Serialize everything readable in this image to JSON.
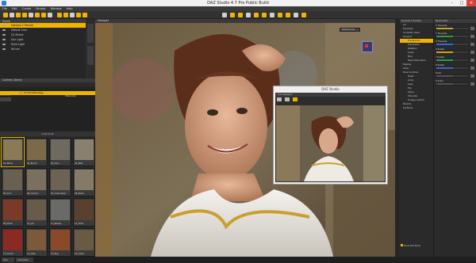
{
  "window": {
    "title": "DAZ Studio 4.7 Pro Public Build"
  },
  "menubar": [
    "File",
    "Edit",
    "Create",
    "Render",
    "Window",
    "Help"
  ],
  "left_tabs": {
    "scene": "Scene"
  },
  "scene_tree": [
    {
      "label": "Genesis 2 Female",
      "selected": true
    },
    {
      "label": "Default Cam",
      "selected": false
    },
    {
      "label": "G2 BlueLt",
      "selected": false
    },
    {
      "label": "Sun Light",
      "selected": false
    },
    {
      "label": "Point Light",
      "selected": false
    },
    {
      "label": "Atrium",
      "selected": false
    }
  ],
  "content": {
    "title": "Content Library",
    "folder_selected": "04 PortalFantasy",
    "folder_child": "Materials",
    "pager": "1-32 of 32",
    "thumbnails": [
      {
        "label": "01_Niche",
        "color": "#8a7a55",
        "selected": true
      },
      {
        "label": "02_Bench",
        "color": "#7a6a4a",
        "selected": false
      },
      {
        "label": "03_Door",
        "color": "#6f6a60",
        "selected": false
      },
      {
        "label": "04_Wall",
        "color": "#8a8070",
        "selected": false
      },
      {
        "label": "05_Arch",
        "color": "#6a6050",
        "selected": false
      },
      {
        "label": "06_Column",
        "color": "#7a7060",
        "selected": false
      },
      {
        "label": "07_Colonnade",
        "color": "#6e6252",
        "selected": false
      },
      {
        "label": "08_Stairs",
        "color": "#857a66",
        "selected": false
      },
      {
        "label": "09_Divan",
        "color": "#7a3a2a",
        "selected": false
      },
      {
        "label": "10_Urn",
        "color": "#6a5a4a",
        "selected": false
      },
      {
        "label": "11_Statue",
        "color": "#6a6a66",
        "selected": false
      },
      {
        "label": "12_Chair",
        "color": "#5a4030",
        "selected": false
      },
      {
        "label": "13_Couch",
        "color": "#8a2a22",
        "selected": false
      },
      {
        "label": "14_Vase",
        "color": "#7a5a3a",
        "selected": false
      },
      {
        "label": "15_Rug",
        "color": "#8a4a2a",
        "selected": false
      },
      {
        "label": "16_Lamp",
        "color": "#6a5a44",
        "selected": false
      }
    ]
  },
  "viewport": {
    "tab": "Viewport",
    "camera": "Default Cam"
  },
  "aux_window": {
    "title": "DAZ Studio",
    "tab": "Aux Viewport"
  },
  "right_panel": {
    "title": "Genesis 2 Female",
    "items": [
      {
        "label": "All",
        "selected": false,
        "sub": false
      },
      {
        "label": "Favorites",
        "selected": false,
        "sub": false
      },
      {
        "label": "Currently Used",
        "selected": false,
        "sub": false
      },
      {
        "label": "General",
        "selected": false,
        "sub": false
      },
      {
        "label": "Transforms",
        "selected": true,
        "sub": true
      },
      {
        "label": "Translation",
        "selected": false,
        "sub": true
      },
      {
        "label": "Rotation",
        "selected": false,
        "sub": true
      },
      {
        "label": "Scale",
        "selected": false,
        "sub": true
      },
      {
        "label": "Misc",
        "selected": false,
        "sub": true
      },
      {
        "label": "Mesh Resolution",
        "selected": false,
        "sub": true
      },
      {
        "label": "Display",
        "selected": false,
        "sub": false
      },
      {
        "label": "Actor",
        "selected": false,
        "sub": false
      },
      {
        "label": "Pose Controls",
        "selected": false,
        "sub": false
      },
      {
        "label": "Head",
        "selected": false,
        "sub": true
      },
      {
        "label": "Arms",
        "selected": false,
        "sub": true
      },
      {
        "label": "Legs",
        "selected": false,
        "sub": true
      },
      {
        "label": "Hip",
        "selected": false,
        "sub": true
      },
      {
        "label": "Spine",
        "selected": false,
        "sub": true
      },
      {
        "label": "Shoulder",
        "selected": false,
        "sub": true
      },
      {
        "label": "Tongue Control",
        "selected": false,
        "sub": true
      },
      {
        "label": "Morphs",
        "selected": false,
        "sub": false
      },
      {
        "label": "Surfaces",
        "selected": false,
        "sub": false
      }
    ],
    "footer": "Show Sub Items"
  },
  "params": {
    "header": "Parameters",
    "rows": [
      {
        "label": "X Translate",
        "fill": 0.5,
        "color": "#c9a420"
      },
      {
        "label": "Y Translate",
        "fill": 0.5,
        "color": "#2fa04a"
      },
      {
        "label": "Z Translate",
        "fill": 0.5,
        "color": "#3a6ad0"
      },
      {
        "label": "X Rotate",
        "fill": 0.5,
        "color": "#c9a420"
      },
      {
        "label": "Y Rotate",
        "fill": 0.5,
        "color": "#2fa04a"
      },
      {
        "label": "Z Rotate",
        "fill": 0.5,
        "color": "#3a6ad0"
      },
      {
        "label": "Scale",
        "fill": 0.5,
        "color": "#555555"
      },
      {
        "label": "X Scale",
        "fill": 0.5,
        "color": "#555555"
      }
    ]
  },
  "status_tabs": [
    "Tips",
    "Animation"
  ],
  "colors": {
    "accent": "#f0b400",
    "panel": "#2a2a2a"
  }
}
